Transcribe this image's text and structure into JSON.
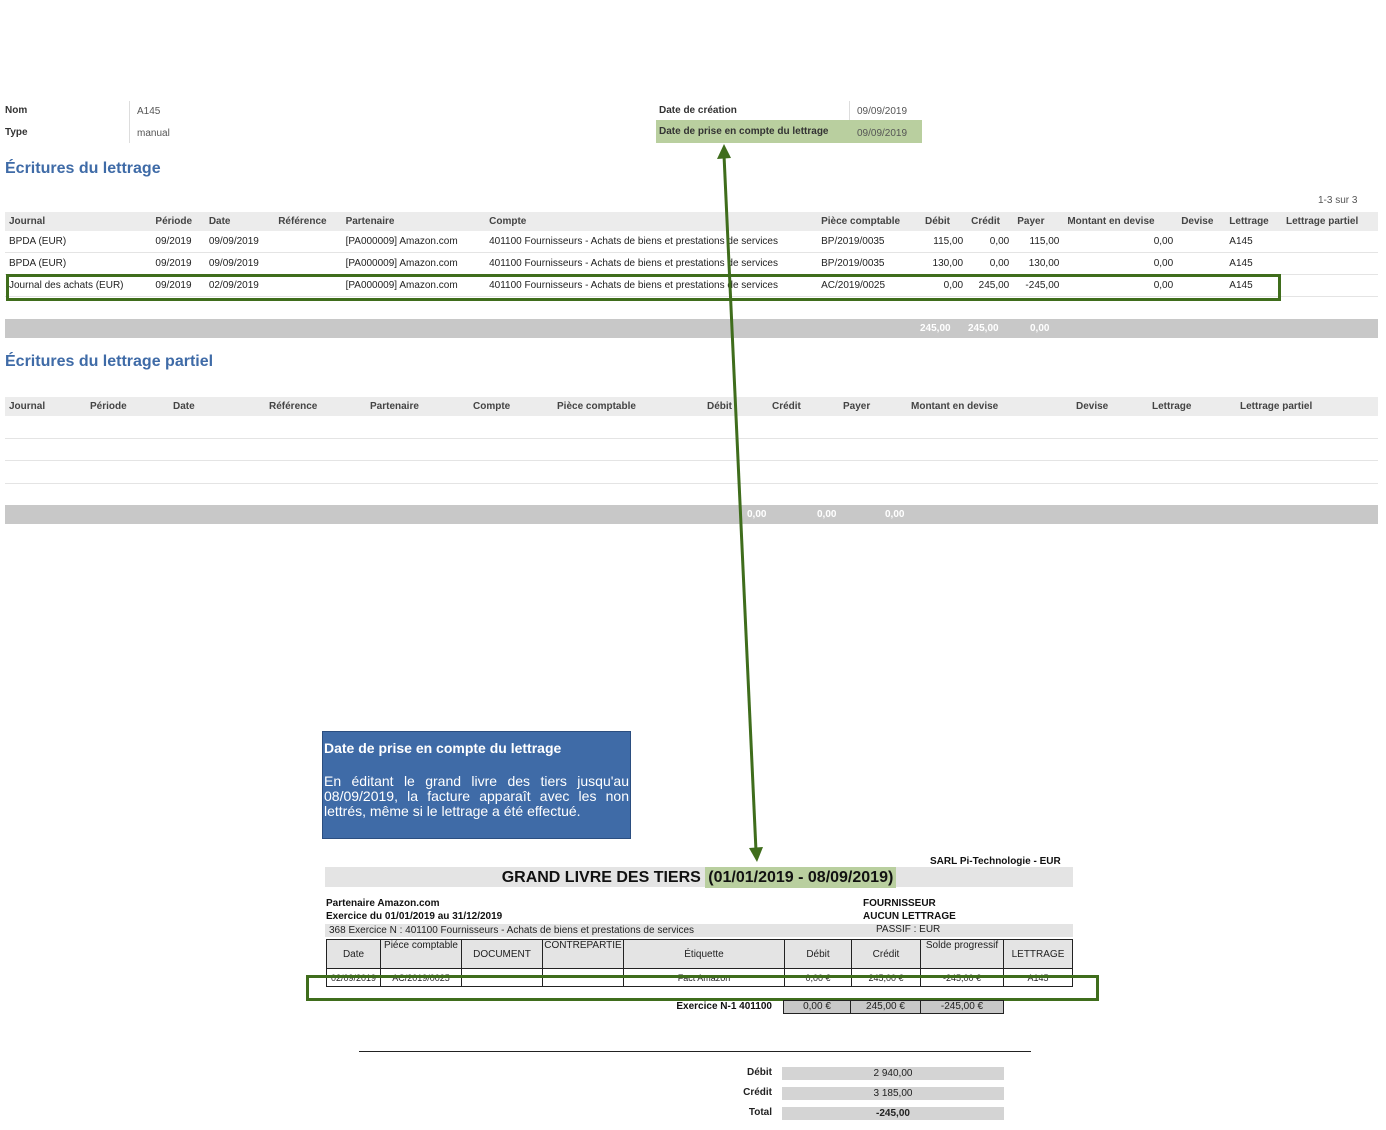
{
  "record": {
    "nom_label": "Nom",
    "nom_value": "A145",
    "type_label": "Type",
    "type_value": "manual",
    "date_creation_label": "Date de création",
    "date_creation_value": "09/09/2019",
    "date_prise_label": "Date de prise en compte du lettrage",
    "date_prise_value": "09/09/2019"
  },
  "lettrage": {
    "title": "Écritures du lettrage",
    "pager": "1-3 sur 3",
    "columns": [
      "Journal",
      "Période",
      "Date",
      "Référence",
      "Partenaire",
      "Compte",
      "Pièce comptable",
      "Débit",
      "Crédit",
      "Payer",
      "Montant en devise",
      "Devise",
      "Lettrage",
      "Lettrage partiel"
    ],
    "rows": [
      [
        "BPDA (EUR)",
        "09/2019",
        "09/09/2019",
        "",
        "[PA000009] Amazon.com",
        "401100 Fournisseurs - Achats de biens et prestations de services",
        "BP/2019/0035",
        "115,00",
        "0,00",
        "115,00",
        "0,00",
        "",
        "A145",
        ""
      ],
      [
        "BPDA (EUR)",
        "09/2019",
        "09/09/2019",
        "",
        "[PA000009] Amazon.com",
        "401100 Fournisseurs - Achats de biens et prestations de services",
        "BP/2019/0035",
        "130,00",
        "0,00",
        "130,00",
        "0,00",
        "",
        "A145",
        ""
      ],
      [
        "Journal des achats (EUR)",
        "09/2019",
        "02/09/2019",
        "",
        "[PA000009] Amazon.com",
        "401100 Fournisseurs - Achats de biens et prestations de services",
        "AC/2019/0025",
        "0,00",
        "245,00",
        "-245,00",
        "0,00",
        "",
        "A145",
        ""
      ]
    ],
    "totals": {
      "debit": "245,00",
      "credit": "245,00",
      "payer": "0,00"
    }
  },
  "lettrage_partiel": {
    "title": "Écritures du lettrage partiel",
    "columns": [
      "Journal",
      "Période",
      "Date",
      "Référence",
      "Partenaire",
      "Compte",
      "Pièce comptable",
      "Débit",
      "Crédit",
      "Payer",
      "Montant en devise",
      "Devise",
      "Lettrage",
      "Lettrage partiel"
    ],
    "totals": {
      "debit": "0,00",
      "credit": "0,00",
      "payer": "0,00"
    }
  },
  "info_box": {
    "heading": "Date de prise en compte du lettrage",
    "body": "En éditant le grand livre des tiers jusqu'au 08/09/2019, la facture apparaît avec les non lettrés, même si le lettrage a été effectué."
  },
  "grand_livre": {
    "company": "SARL Pi-Technologie - EUR",
    "title_main": "GRAND LIVRE DES TIERS ",
    "title_period": "(01/01/2019 - 08/09/2019)",
    "partenaire": "Partenaire Amazon.com",
    "exercice": "Exercice du 01/01/2019 au 31/12/2019",
    "fournisseur": "FOURNISSEUR",
    "aucun_lettrage": "AUCUN LETTRAGE",
    "account_line": "368  Exercice N : 401100 Fournisseurs - Achats de biens et prestations de services",
    "passif": "PASSIF : EUR",
    "columns": [
      "Date",
      "Piéce comptable",
      "DOCUMENT",
      "CONTREPARTIE",
      "Étiquette",
      "Débit",
      "Crédit",
      "Solde progressif",
      "LETTRAGE"
    ],
    "row": [
      "02/09/2019",
      "AC/2019/0025",
      "",
      "",
      "Fact Amazon",
      "0,00 €",
      "245,00 €",
      "-245,00 €",
      "A145"
    ],
    "exercice_label": "Exercice N-1 401100",
    "exercice_debit": "0,00 €",
    "exercice_credit": "245,00 €",
    "exercice_solde": "-245,00 €",
    "summary": {
      "debit_label": "Débit",
      "debit_value": "2 940,00",
      "credit_label": "Crédit",
      "credit_value": "3 185,00",
      "total_label": "Total",
      "total_value": "-245,00"
    }
  },
  "colors": {
    "accent": "#3f6ba7",
    "highlight_green": "#3f6d1c",
    "highlight_fill": "#b9cf9f"
  }
}
